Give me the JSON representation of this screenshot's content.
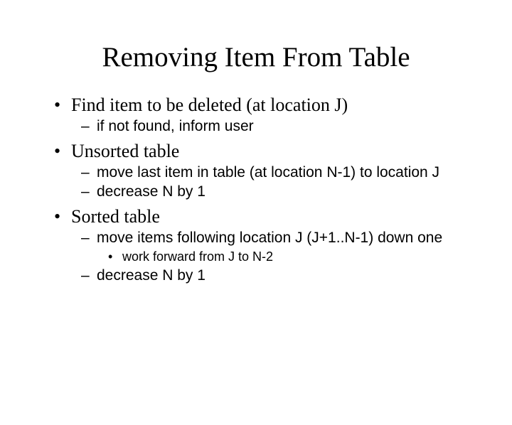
{
  "slide": {
    "title": "Removing Item From Table",
    "items": [
      {
        "text": "Find item to be deleted (at location J)",
        "children": [
          {
            "text": "if not found, inform user"
          }
        ]
      },
      {
        "text": "Unsorted table",
        "children": [
          {
            "text": "move last item in table (at location N-1) to location J"
          },
          {
            "text": "decrease N by 1"
          }
        ]
      },
      {
        "text": "Sorted table",
        "children": [
          {
            "text": "move items following location J (J+1..N-1) down one",
            "children": [
              {
                "text": "work forward from J to N-2"
              }
            ]
          },
          {
            "text": "decrease N by 1"
          }
        ]
      }
    ]
  }
}
